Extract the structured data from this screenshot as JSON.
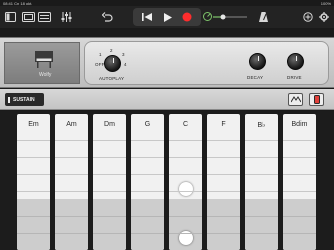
{
  "status_bar": {
    "time": "08:41",
    "date": "Cn 18 okt.",
    "battery": "100%"
  },
  "toolbar": {
    "icons": [
      "sidebar-icon",
      "browser-icon",
      "tracks-icon",
      "mixer-icon",
      "undo-icon",
      "rewind-icon",
      "play-icon",
      "record-icon",
      "tuner-icon",
      "volume-slider",
      "metronome-icon",
      "loop-icon",
      "settings-icon"
    ],
    "record_color": "#ff2d2d"
  },
  "instrument": {
    "name": "Wolfy",
    "autoplay_label": "AUTOPLAY",
    "autoplay_positions": [
      "OFF",
      "1",
      "2",
      "3",
      "4"
    ],
    "decay_label": "DECAY",
    "drive_label": "DRIVE"
  },
  "controls": {
    "sustain_label": "SUSTAIN",
    "active_toggle_color": "#e0403a"
  },
  "chords": [
    {
      "name": "Em"
    },
    {
      "name": "Am"
    },
    {
      "name": "Dm"
    },
    {
      "name": "G"
    },
    {
      "name": "C"
    },
    {
      "name": "F"
    },
    {
      "name": "B♭"
    },
    {
      "name": "Bdim"
    }
  ]
}
